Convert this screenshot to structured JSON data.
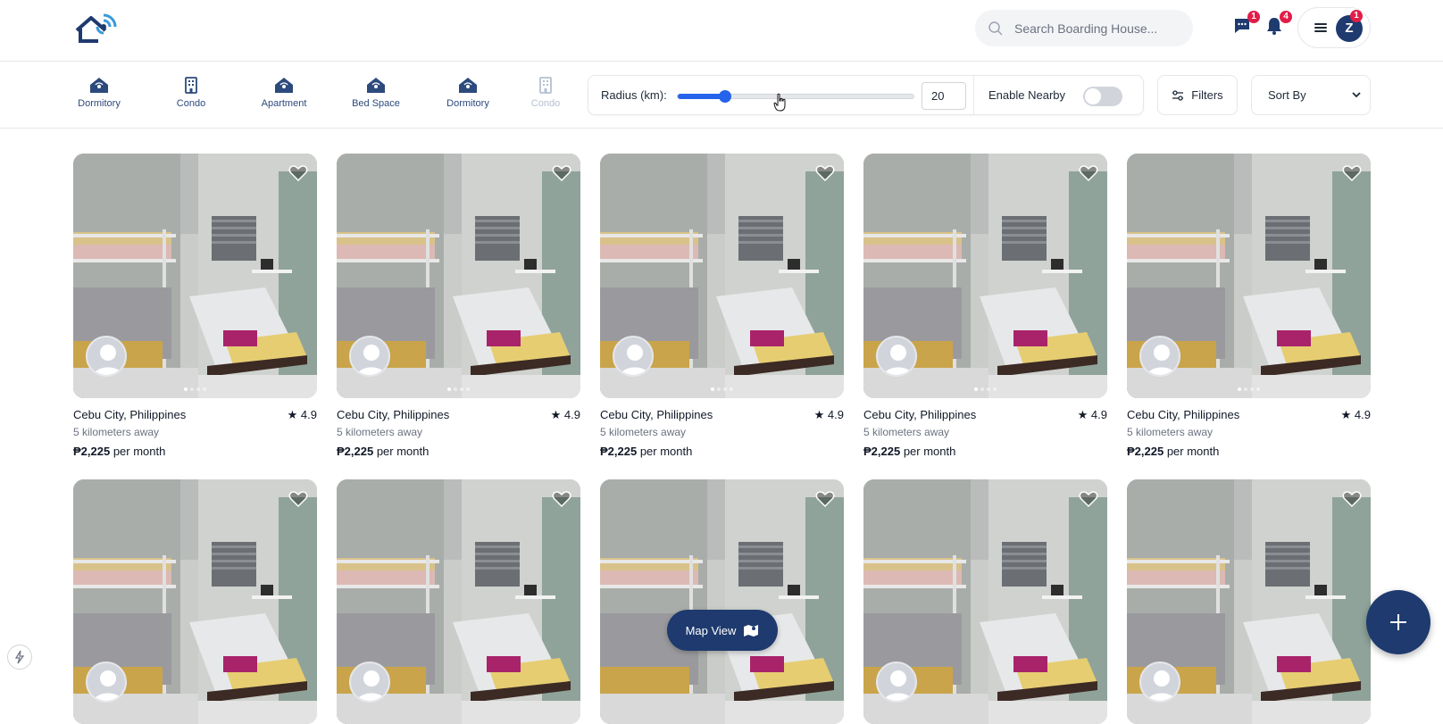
{
  "header": {
    "search_placeholder": "Search Boarding House...",
    "messages_badge": "1",
    "notifications_badge": "4",
    "menu_badge": "1",
    "avatar_initial": "Z"
  },
  "categories": [
    {
      "label": "Dormitory",
      "icon": "house-signal-icon"
    },
    {
      "label": "Condo",
      "icon": "building-icon"
    },
    {
      "label": "Apartment",
      "icon": "house-signal-icon"
    },
    {
      "label": "Bed Space",
      "icon": "house-signal-icon"
    },
    {
      "label": "Dormitory",
      "icon": "house-signal-icon"
    },
    {
      "label": "Condo",
      "icon": "building-icon"
    }
  ],
  "filters": {
    "radius_label": "Radius (km):",
    "radius_value": "20",
    "radius_fraction": 0.2,
    "nearby_label": "Enable Nearby",
    "nearby_enabled": false,
    "filters_button": "Filters",
    "sort_label": "Sort By"
  },
  "listings": [
    {
      "location": "Cebu City, Philippines",
      "rating": "4.9",
      "distance": "5 kilometers away",
      "price": "₱2,225",
      "price_unit": "per month"
    },
    {
      "location": "Cebu City, Philippines",
      "rating": "4.9",
      "distance": "5 kilometers away",
      "price": "₱2,225",
      "price_unit": "per month"
    },
    {
      "location": "Cebu City, Philippines",
      "rating": "4.9",
      "distance": "5 kilometers away",
      "price": "₱2,225",
      "price_unit": "per month"
    },
    {
      "location": "Cebu City, Philippines",
      "rating": "4.9",
      "distance": "5 kilometers away",
      "price": "₱2,225",
      "price_unit": "per month"
    },
    {
      "location": "Cebu City, Philippines",
      "rating": "4.9",
      "distance": "5 kilometers away",
      "price": "₱2,225",
      "price_unit": "per month"
    },
    {
      "location": "",
      "rating": "",
      "distance": "",
      "price": "",
      "price_unit": ""
    },
    {
      "location": "",
      "rating": "",
      "distance": "",
      "price": "",
      "price_unit": ""
    },
    {
      "location": "",
      "rating": "",
      "distance": "",
      "price": "",
      "price_unit": ""
    },
    {
      "location": "",
      "rating": "",
      "distance": "",
      "price": "",
      "price_unit": ""
    },
    {
      "location": "",
      "rating": "",
      "distance": "",
      "price": "",
      "price_unit": ""
    }
  ],
  "map_view_label": "Map View",
  "colors": {
    "brand_navy": "#1e3a6e",
    "accent_blue": "#2563eb",
    "badge_red": "#e11d48"
  }
}
